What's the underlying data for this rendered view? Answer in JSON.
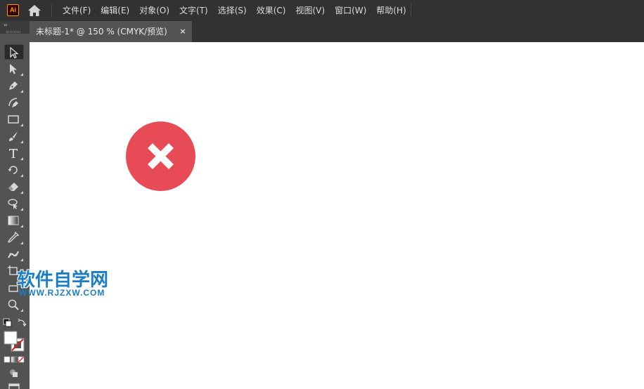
{
  "app": {
    "logo_text": "Ai",
    "logo_color": "#ff9a00"
  },
  "menu": {
    "items": [
      {
        "label": "文件(F)"
      },
      {
        "label": "编辑(E)"
      },
      {
        "label": "对象(O)"
      },
      {
        "label": "文字(T)"
      },
      {
        "label": "选择(S)"
      },
      {
        "label": "效果(C)"
      },
      {
        "label": "视图(V)"
      },
      {
        "label": "窗口(W)"
      },
      {
        "label": "帮助(H)"
      }
    ]
  },
  "document_tab": {
    "title": "未标题-1* @ 150 % (CMYK/预览)",
    "close_glyph": "×"
  },
  "toolbar": {
    "collapse_glyph": "››",
    "tools": [
      {
        "name": "selection-tool",
        "icon": "selection-arrow-icon",
        "active": true
      },
      {
        "name": "direct-selection-tool",
        "icon": "direct-selection-icon",
        "active": false
      },
      {
        "name": "pen-tool",
        "icon": "pen-icon",
        "active": false
      },
      {
        "name": "curvature-tool",
        "icon": "curvature-pen-icon",
        "active": false
      },
      {
        "name": "rectangle-tool",
        "icon": "rectangle-icon",
        "active": false
      },
      {
        "name": "paintbrush-tool",
        "icon": "paintbrush-icon",
        "active": false
      },
      {
        "name": "type-tool",
        "icon": "type-icon",
        "active": false
      },
      {
        "name": "rotate-tool",
        "icon": "rotate-icon",
        "active": false
      },
      {
        "name": "eraser-tool",
        "icon": "eraser-icon",
        "active": false
      },
      {
        "name": "shape-builder-tool",
        "icon": "lasso-icon",
        "active": false
      },
      {
        "name": "gradient-tool",
        "icon": "gradient-icon",
        "active": false
      },
      {
        "name": "eyedropper-tool",
        "icon": "eyedropper-icon",
        "active": false
      },
      {
        "name": "puppet-warp-tool",
        "icon": "puppet-warp-icon",
        "active": false
      },
      {
        "name": "artboard-tool",
        "icon": "artboard-icon",
        "active": false
      },
      {
        "name": "hand-tool",
        "icon": "hand-icon",
        "active": false
      },
      {
        "name": "zoom-tool",
        "icon": "zoom-icon",
        "active": false
      }
    ]
  },
  "canvas": {
    "background": "#ffffff",
    "shape": {
      "type": "close-circle",
      "icon": "close-circle-icon",
      "fill": "#e64b56",
      "mark_color": "#ffffff"
    }
  },
  "watermark": {
    "title": "软件自学网",
    "url": "WWW.RJZXW.COM",
    "color": "#1b7ec2"
  }
}
